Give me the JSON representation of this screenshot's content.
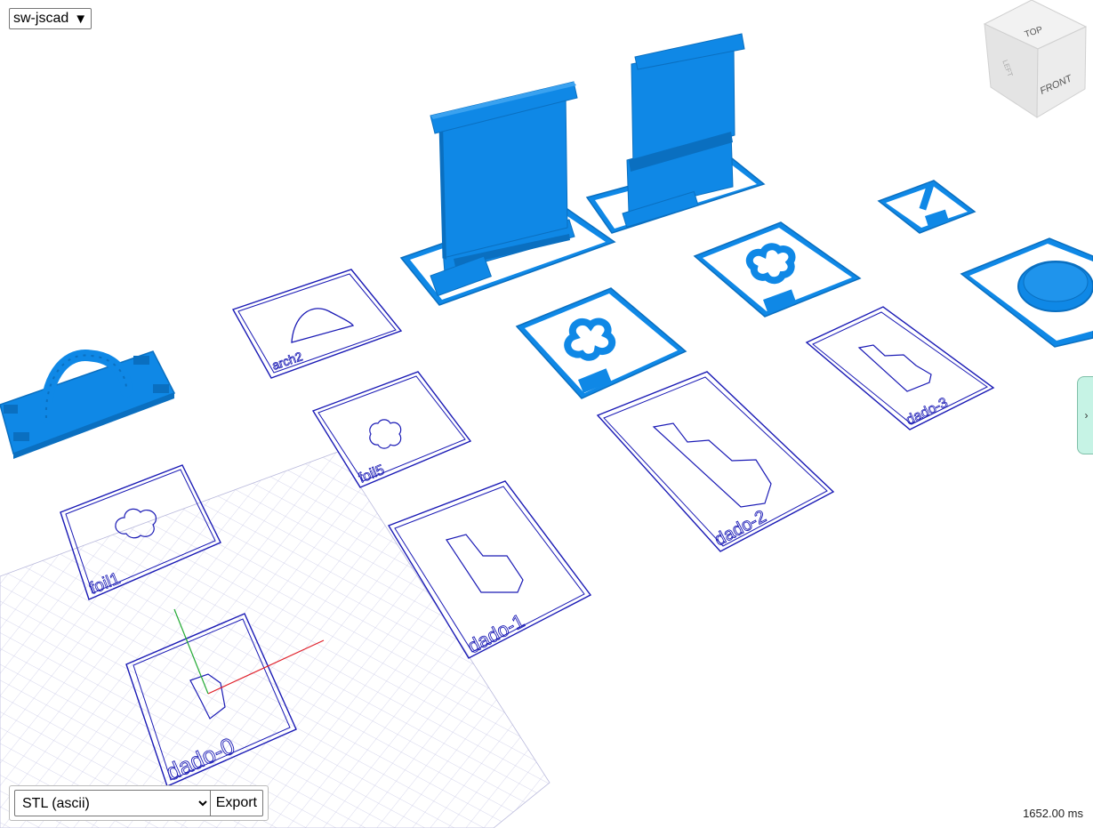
{
  "model_selector": {
    "label": "sw-jscad",
    "arrow": "▼"
  },
  "view_cube": {
    "faces": {
      "top": "TOP",
      "front": "FRONT",
      "left": "LEFT"
    }
  },
  "parts": {
    "labels": [
      "arch2",
      "foil1",
      "foil5",
      "dado-0",
      "dado-1",
      "dado-2",
      "dado-3"
    ]
  },
  "export": {
    "format_selected": "STL (ascii)",
    "button_label": "Export"
  },
  "status": {
    "render_time": "1652.00 ms"
  },
  "side_panel": {
    "toggle_icon": "›"
  },
  "colors": {
    "solid": "#0f88e6",
    "solid_dark": "#0a6fc0",
    "outline": "#1a1ab5",
    "grid": "#cccce8",
    "axis_x": "#e0202a",
    "axis_y": "#22aa33",
    "panel_tab": "#c6f3e5"
  }
}
